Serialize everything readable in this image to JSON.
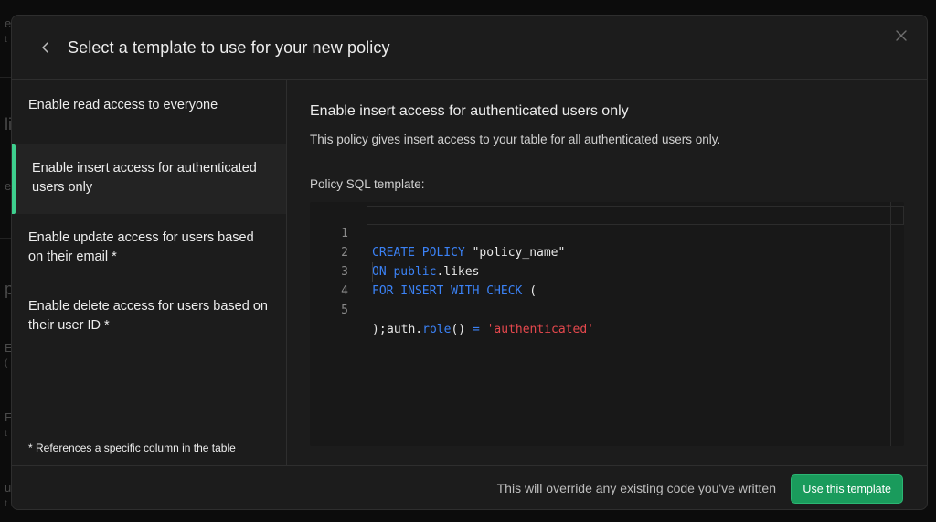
{
  "background_page": {
    "fragments": [
      "e",
      "t",
      "li",
      "e",
      "p",
      "E",
      "(",
      "E",
      "t",
      "u",
      "t"
    ]
  },
  "modal": {
    "title": "Select a template to use for your new policy",
    "back_icon": "chevron-left-icon",
    "close_icon": "close-icon"
  },
  "templates": [
    {
      "label": "Enable read access to everyone",
      "active": false
    },
    {
      "label": "Enable insert access for authenticated users only",
      "active": true
    },
    {
      "label": "Enable update access for users based on their email *",
      "active": false
    },
    {
      "label": "Enable delete access for users based on their user ID *",
      "active": false
    }
  ],
  "footnote": "* References a specific column in the table",
  "detail": {
    "title": "Enable insert access for authenticated users only",
    "description": "This policy gives insert access to your table for all authenticated users only.",
    "sql_label": "Policy SQL template:"
  },
  "sql": {
    "line_numbers": [
      "1",
      "2",
      "3",
      "4",
      "5"
    ],
    "line1": {
      "kw": "CREATE POLICY",
      "rest": " \"policy_name\""
    },
    "line2": {
      "kw1": "ON",
      "sp": " ",
      "kw2": "public",
      "rest": ".likes"
    },
    "line3": {
      "kw": "FOR INSERT WITH CHECK",
      "rest": " ("
    },
    "line4": {
      "fn_a": "auth.",
      "fn_b": "role",
      "mid": "() ",
      "op": "=",
      "sp": " ",
      "str": "'authenticated'"
    },
    "line5": {
      "text": ");"
    }
  },
  "footer": {
    "note": "This will override any existing code you've written",
    "button": "Use this template"
  },
  "colors": {
    "accent": "#3ecf8e",
    "button": "#1a9b5c",
    "keyword": "#3b82f6",
    "string_literal": "#e5484d"
  }
}
